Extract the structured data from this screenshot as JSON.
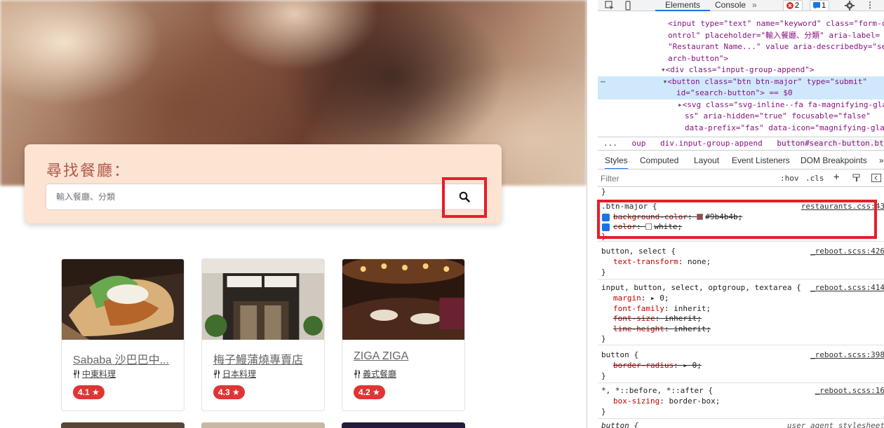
{
  "search": {
    "title": "尋找餐廳：",
    "placeholder": "輸入餐廳、分類"
  },
  "restaurants": [
    {
      "name": "Sababa 沙巴巴中...",
      "category": "中東料理",
      "rating": "4.1"
    },
    {
      "name": "梅子鰻蒲燒專賣店",
      "category": "日本料理",
      "rating": "4.3"
    },
    {
      "name": "ZIGA ZIGA",
      "category": "義式餐廳",
      "rating": "4.2"
    }
  ],
  "devtools": {
    "tabs": [
      "Elements",
      "Console"
    ],
    "error_count": "2",
    "message_count": "1",
    "elements_lines": [
      {
        "indent": 0,
        "text": "<input type=\"text\" name=\"keyword\" class=\"form-c"
      },
      {
        "indent": 0,
        "text": "ontrol\" placeholder=\"輸入餐廳、分類\" aria-label="
      },
      {
        "indent": 0,
        "text": "\"Restaurant Name...\" value aria-describedby=\"se"
      },
      {
        "indent": 0,
        "text": "arch-button\">"
      },
      {
        "indent": 1,
        "text": "<div class=\"input-group-append\">"
      },
      {
        "indent": 2,
        "text": "<button class=\"btn btn-major\" type=\"submit\""
      },
      {
        "indent": 2,
        "text": "id=\"search-button\"> == $0"
      },
      {
        "indent": 3,
        "text": "<svg class=\"svg-inline--fa fa-magnifying-gla"
      },
      {
        "indent": 3,
        "text": "ss\" aria-hidden=\"true\" focusable=\"false\""
      },
      {
        "indent": 3,
        "text": "data-prefix=\"fas\" data-icon=\"magnifying-gla"
      }
    ],
    "breadcrumbs": [
      "...",
      "oup",
      "div.input-group-append",
      "button#search-button.btn.btn-major"
    ],
    "subtabs": [
      "Styles",
      "Computed",
      "Layout",
      "Event Listeners",
      "DOM Breakpoints",
      "»"
    ],
    "filter_placeholder": "Filter",
    "filter_tools": [
      ":hov",
      ".cls",
      "+"
    ],
    "rules": [
      {
        "selector": ".btn-major {",
        "source": "restaurants.css:43",
        "props": [
          {
            "name": "background-color",
            "value": "#9b4b4b;",
            "struck": true,
            "checked": true,
            "swatch": "#9b4b4b"
          },
          {
            "name": "color",
            "value": "white;",
            "struck": true,
            "checked": true,
            "swatch": "#ffffff"
          }
        ]
      },
      {
        "selector": "button, select {",
        "source": "_reboot.scss:426",
        "props": [
          {
            "name": "text-transform",
            "value": "none;",
            "struck": false
          }
        ]
      },
      {
        "selector": "input, button, select, optgroup, textarea {",
        "source": "_reboot.scss:414",
        "props": [
          {
            "name": "margin",
            "value": "▸ 0;",
            "struck": false
          },
          {
            "name": "font-family",
            "value": "inherit;",
            "struck": false
          },
          {
            "name": "font-size",
            "value": "inherit;",
            "struck": true
          },
          {
            "name": "line-height",
            "value": "inherit;",
            "struck": true
          }
        ]
      },
      {
        "selector": "button {",
        "source": "_reboot.scss:398",
        "props": [
          {
            "name": "border-radius",
            "value": "▸ 0;",
            "struck": true
          }
        ]
      },
      {
        "selector": "*, *::before, *::after {",
        "source": "_reboot.scss:16",
        "props": [
          {
            "name": "box-sizing",
            "value": "border-box;",
            "struck": false
          }
        ]
      },
      {
        "selector": "button {",
        "source": "user agent stylesheet",
        "props": []
      }
    ]
  }
}
